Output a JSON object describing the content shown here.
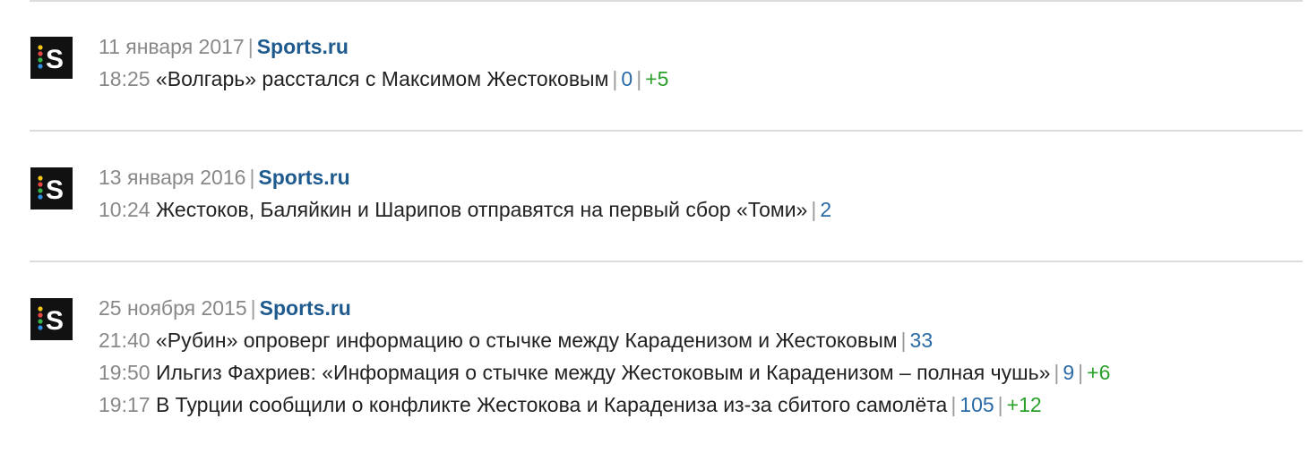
{
  "colors": {
    "source_link": "#1e5a8e",
    "comments": "#2a6aa6",
    "rating_positive": "#2aa02a",
    "meta_gray": "#888888",
    "divider": "#dcdcdc"
  },
  "icons": {
    "source_logo": "sports-ru-logo-icon"
  },
  "groups": [
    {
      "date": "11 января 2017",
      "source": "Sports.ru",
      "items": [
        {
          "time": "18:25",
          "title": "«Волгарь» расстался с Максимом Жестоковым",
          "comments": "0",
          "rating": "+5"
        }
      ]
    },
    {
      "date": "13 января 2016",
      "source": "Sports.ru",
      "items": [
        {
          "time": "10:24",
          "title": "Жестоков, Баляйкин и Шарипов отправятся на первый сбор «Томи»",
          "comments": "2"
        }
      ]
    },
    {
      "date": "25 ноября 2015",
      "source": "Sports.ru",
      "items": [
        {
          "time": "21:40",
          "title": "«Рубин» опроверг информацию о стычке между Караденизом и Жестоковым",
          "comments": "33"
        },
        {
          "time": "19:50",
          "title": "Ильгиз Фахриев: «Информация о стычке между Жестоковым и Караденизом – полная чушь»",
          "comments": "9",
          "rating": "+6"
        },
        {
          "time": "19:17",
          "title": "В Турции сообщили о конфликте Жестокова и Карадениза из-за сбитого самолёта",
          "comments": "105",
          "rating": "+12"
        }
      ]
    }
  ]
}
